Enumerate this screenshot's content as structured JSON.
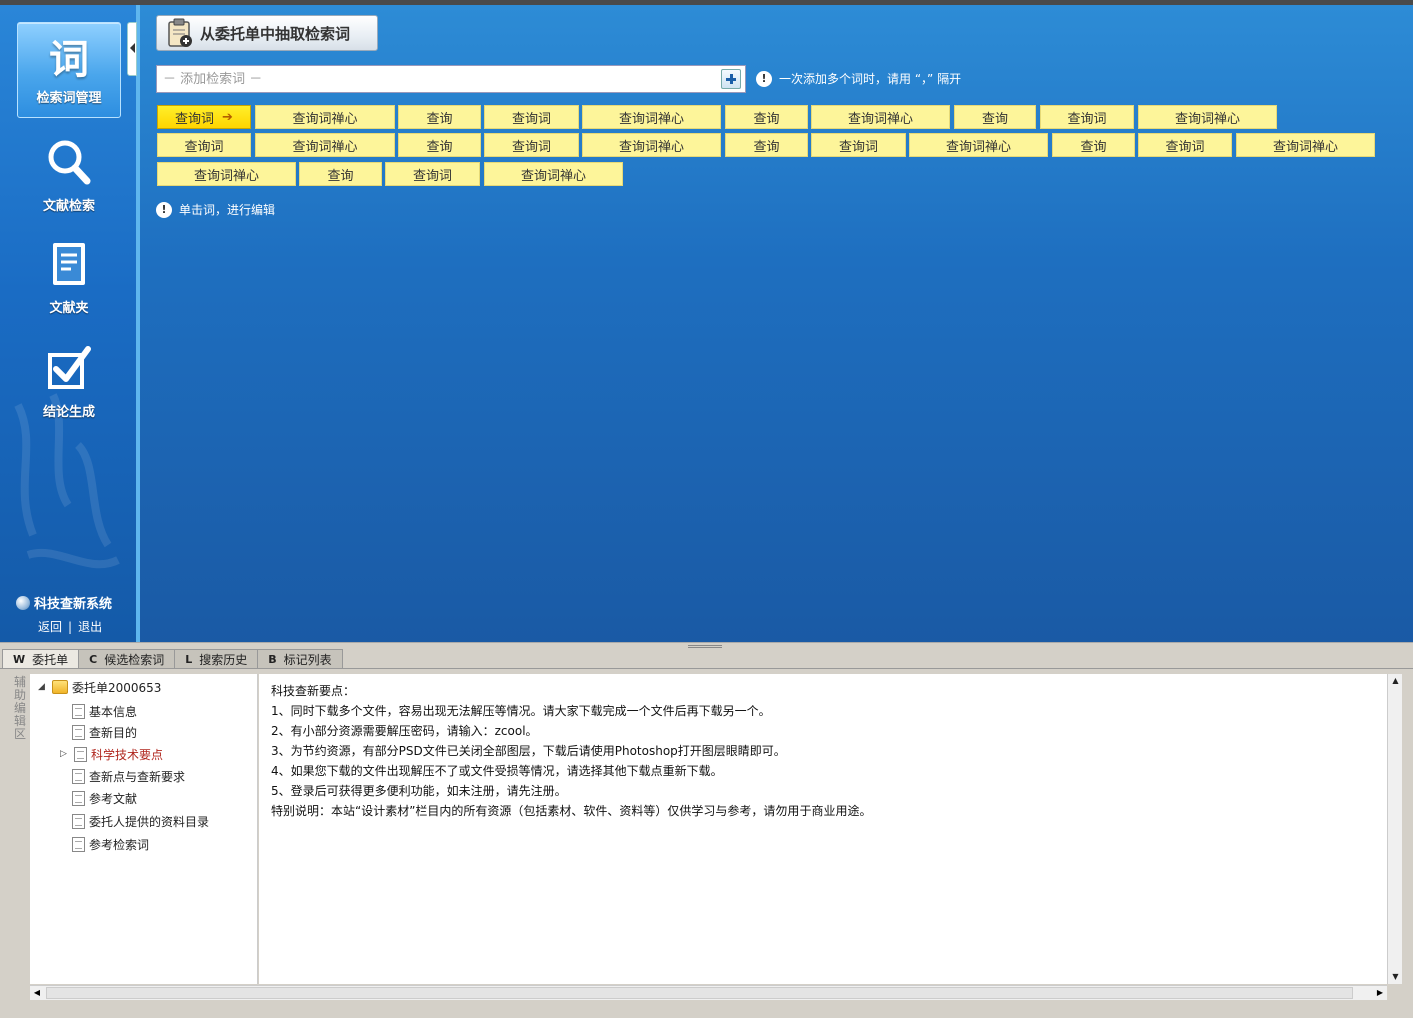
{
  "sidebar": {
    "items": [
      {
        "glyph": "词",
        "label": "检索词管理",
        "icon": "word-icon",
        "active": true
      },
      {
        "label": "文献检索",
        "icon": "search-icon"
      },
      {
        "label": "文献夹",
        "icon": "folder-doc-icon"
      },
      {
        "label": "结论生成",
        "icon": "checkbox-icon"
      }
    ],
    "brand": "科技查新系统",
    "back": "返回",
    "separator": "|",
    "logout": "退出"
  },
  "toolbar": {
    "extract_label": "从委托单中抽取检索词"
  },
  "search": {
    "placeholder": "－ 添加检索词 －",
    "hint": "一次添加多个词时，请用 “，” 隔开"
  },
  "chips": [
    "查询词",
    "查询词禅心",
    "查询",
    "查询词",
    "查询词禅心",
    "查询",
    "查询词禅心",
    "查询",
    "查询词",
    "查询词禅心",
    "查询词",
    "查询词禅心",
    "查询",
    "查询词",
    "查询词禅心",
    "查询",
    "查询词",
    "查询词禅心",
    "查询",
    "查询词",
    "查询词禅心",
    "查询词禅心",
    "查询",
    "查询词",
    "查询词禅心"
  ],
  "edit_hint": "单击词，进行编辑",
  "tabs": [
    {
      "key": "W",
      "label": "委托单",
      "active": true
    },
    {
      "key": "C",
      "label": "候选检索词"
    },
    {
      "key": "L",
      "label": "搜索历史"
    },
    {
      "key": "B",
      "label": "标记列表"
    }
  ],
  "aux_label": "辅助编辑区",
  "tree": {
    "root": "委托单2000653",
    "items": [
      "基本信息",
      "查新目的",
      "科学技术要点",
      "查新点与查新要求",
      "参考文献",
      "委托人提供的资料目录",
      "参考检索词"
    ]
  },
  "content": {
    "lines": [
      "科技查新要点：",
      "1、同时下载多个文件，容易出现无法解压等情况。请大家下载完成一个文件后再下载另一个。",
      "2、有小部分资源需要解压密码，请输入：zcool。",
      "3、为节约资源，有部分PSD文件已关闭全部图层，下载后请使用Photoshop打开图层眼睛即可。",
      "4、如果您下载的文件出现解压不了或文件受损等情况，请选择其他下载点重新下载。",
      "5、登录后可获得更多便利功能，如未注册，请先注册。",
      "特别说明：本站“设计素材”栏目内的所有资源（包括素材、软件、资料等）仅供学习与参考，请勿用于商业用途。"
    ]
  },
  "colors": {
    "sidebar": "#1a6cc4",
    "main": "#1e6fc0",
    "chip": "#fdf59a",
    "chip_selected": "#ffd500",
    "tree_highlight": "#b0261e"
  }
}
